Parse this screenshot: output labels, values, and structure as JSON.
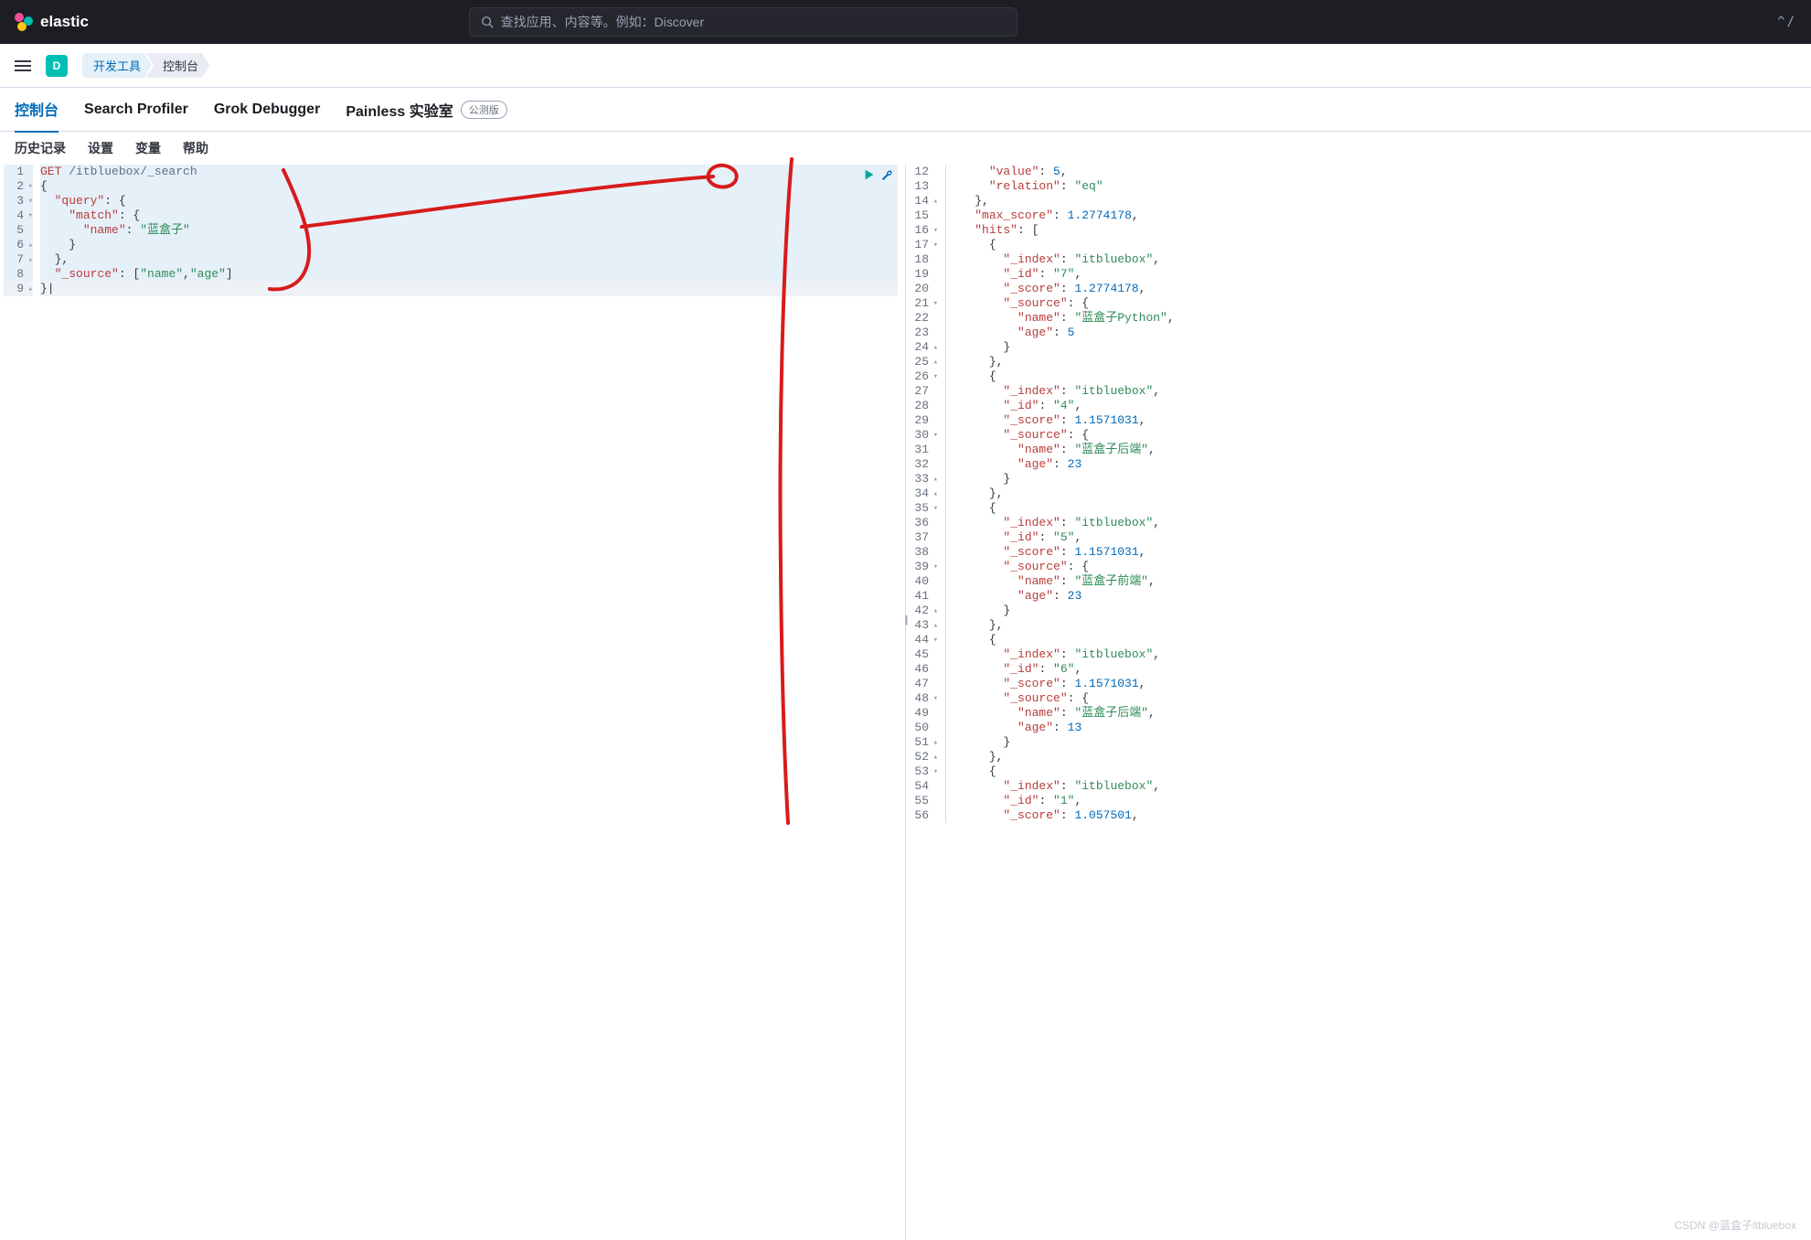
{
  "header": {
    "brand": "elastic",
    "search_placeholder": "查找应用、内容等。例如：Discover",
    "shortcut": "^/"
  },
  "breadcrumb": {
    "badge": "D",
    "items": [
      "开发工具",
      "控制台"
    ]
  },
  "tabs": [
    {
      "label": "控制台",
      "active": true
    },
    {
      "label": "Search Profiler"
    },
    {
      "label": "Grok Debugger"
    },
    {
      "label": "Painless 实验室",
      "badge": "公测版"
    }
  ],
  "subtabs": [
    "历史记录",
    "设置",
    "变量",
    "帮助"
  ],
  "request": {
    "lines": [
      {
        "n": 1,
        "fold": "",
        "hl": true,
        "tokens": [
          [
            "method",
            "GET"
          ],
          [
            "plain",
            " "
          ],
          [
            "path",
            "/itbluebox/_search"
          ]
        ]
      },
      {
        "n": 2,
        "fold": "▾",
        "hl": true,
        "tokens": [
          [
            "punct",
            "{"
          ]
        ]
      },
      {
        "n": 3,
        "fold": "▾",
        "hl": true,
        "tokens": [
          [
            "plain",
            "  "
          ],
          [
            "key",
            "\"query\""
          ],
          [
            "punct",
            ": {"
          ]
        ]
      },
      {
        "n": 4,
        "fold": "▾",
        "hl": true,
        "tokens": [
          [
            "plain",
            "    "
          ],
          [
            "key",
            "\"match\""
          ],
          [
            "punct",
            ": {"
          ]
        ]
      },
      {
        "n": 5,
        "fold": "",
        "hl": true,
        "tokens": [
          [
            "plain",
            "      "
          ],
          [
            "key",
            "\"name\""
          ],
          [
            "punct",
            ": "
          ],
          [
            "str",
            "\"蓝盒子\""
          ]
        ]
      },
      {
        "n": 6,
        "fold": "▴",
        "hl": true,
        "tokens": [
          [
            "plain",
            "    "
          ],
          [
            "punct",
            "}"
          ]
        ]
      },
      {
        "n": 7,
        "fold": "▴",
        "hl": true,
        "tokens": [
          [
            "plain",
            "  "
          ],
          [
            "punct",
            "},"
          ]
        ]
      },
      {
        "n": 8,
        "fold": "",
        "hl": true,
        "tokens": [
          [
            "plain",
            "  "
          ],
          [
            "key",
            "\"_source\""
          ],
          [
            "punct",
            ": ["
          ],
          [
            "str",
            "\"name\""
          ],
          [
            "punct",
            ","
          ],
          [
            "str",
            "\"age\""
          ],
          [
            "punct",
            "]"
          ]
        ]
      },
      {
        "n": 9,
        "fold": "▴",
        "hl": true,
        "hl2": true,
        "tokens": [
          [
            "punct",
            "}|"
          ]
        ]
      }
    ]
  },
  "response": {
    "lines": [
      {
        "n": 12,
        "fold": "",
        "tokens": [
          [
            "plain",
            "      "
          ],
          [
            "key",
            "\"value\""
          ],
          [
            "punct",
            ": "
          ],
          [
            "num",
            "5"
          ],
          [
            "punct",
            ","
          ]
        ]
      },
      {
        "n": 13,
        "fold": "",
        "tokens": [
          [
            "plain",
            "      "
          ],
          [
            "key",
            "\"relation\""
          ],
          [
            "punct",
            ": "
          ],
          [
            "str",
            "\"eq\""
          ]
        ]
      },
      {
        "n": 14,
        "fold": "▴",
        "tokens": [
          [
            "plain",
            "    "
          ],
          [
            "punct",
            "},"
          ]
        ]
      },
      {
        "n": 15,
        "fold": "",
        "tokens": [
          [
            "plain",
            "    "
          ],
          [
            "key",
            "\"max_score\""
          ],
          [
            "punct",
            ": "
          ],
          [
            "num",
            "1.2774178"
          ],
          [
            "punct",
            ","
          ]
        ]
      },
      {
        "n": 16,
        "fold": "▾",
        "tokens": [
          [
            "plain",
            "    "
          ],
          [
            "key",
            "\"hits\""
          ],
          [
            "punct",
            ": ["
          ]
        ]
      },
      {
        "n": 17,
        "fold": "▾",
        "tokens": [
          [
            "plain",
            "      "
          ],
          [
            "punct",
            "{"
          ]
        ]
      },
      {
        "n": 18,
        "fold": "",
        "tokens": [
          [
            "plain",
            "        "
          ],
          [
            "key",
            "\"_index\""
          ],
          [
            "punct",
            ": "
          ],
          [
            "str",
            "\"itbluebox\""
          ],
          [
            "punct",
            ","
          ]
        ]
      },
      {
        "n": 19,
        "fold": "",
        "tokens": [
          [
            "plain",
            "        "
          ],
          [
            "key",
            "\"_id\""
          ],
          [
            "punct",
            ": "
          ],
          [
            "str",
            "\"7\""
          ],
          [
            "punct",
            ","
          ]
        ]
      },
      {
        "n": 20,
        "fold": "",
        "tokens": [
          [
            "plain",
            "        "
          ],
          [
            "key",
            "\"_score\""
          ],
          [
            "punct",
            ": "
          ],
          [
            "num",
            "1.2774178"
          ],
          [
            "punct",
            ","
          ]
        ]
      },
      {
        "n": 21,
        "fold": "▾",
        "tokens": [
          [
            "plain",
            "        "
          ],
          [
            "key",
            "\"_source\""
          ],
          [
            "punct",
            ": {"
          ]
        ]
      },
      {
        "n": 22,
        "fold": "",
        "tokens": [
          [
            "plain",
            "          "
          ],
          [
            "key",
            "\"name\""
          ],
          [
            "punct",
            ": "
          ],
          [
            "str",
            "\"蓝盒子Python\""
          ],
          [
            "punct",
            ","
          ]
        ]
      },
      {
        "n": 23,
        "fold": "",
        "tokens": [
          [
            "plain",
            "          "
          ],
          [
            "key",
            "\"age\""
          ],
          [
            "punct",
            ": "
          ],
          [
            "num",
            "5"
          ]
        ]
      },
      {
        "n": 24,
        "fold": "▴",
        "tokens": [
          [
            "plain",
            "        "
          ],
          [
            "punct",
            "}"
          ]
        ]
      },
      {
        "n": 25,
        "fold": "▴",
        "tokens": [
          [
            "plain",
            "      "
          ],
          [
            "punct",
            "},"
          ]
        ]
      },
      {
        "n": 26,
        "fold": "▾",
        "tokens": [
          [
            "plain",
            "      "
          ],
          [
            "punct",
            "{"
          ]
        ]
      },
      {
        "n": 27,
        "fold": "",
        "tokens": [
          [
            "plain",
            "        "
          ],
          [
            "key",
            "\"_index\""
          ],
          [
            "punct",
            ": "
          ],
          [
            "str",
            "\"itbluebox\""
          ],
          [
            "punct",
            ","
          ]
        ]
      },
      {
        "n": 28,
        "fold": "",
        "tokens": [
          [
            "plain",
            "        "
          ],
          [
            "key",
            "\"_id\""
          ],
          [
            "punct",
            ": "
          ],
          [
            "str",
            "\"4\""
          ],
          [
            "punct",
            ","
          ]
        ]
      },
      {
        "n": 29,
        "fold": "",
        "tokens": [
          [
            "plain",
            "        "
          ],
          [
            "key",
            "\"_score\""
          ],
          [
            "punct",
            ": "
          ],
          [
            "num",
            "1.1571031"
          ],
          [
            "punct",
            ","
          ]
        ]
      },
      {
        "n": 30,
        "fold": "▾",
        "tokens": [
          [
            "plain",
            "        "
          ],
          [
            "key",
            "\"_source\""
          ],
          [
            "punct",
            ": {"
          ]
        ]
      },
      {
        "n": 31,
        "fold": "",
        "tokens": [
          [
            "plain",
            "          "
          ],
          [
            "key",
            "\"name\""
          ],
          [
            "punct",
            ": "
          ],
          [
            "str",
            "\"蓝盒子后端\""
          ],
          [
            "punct",
            ","
          ]
        ]
      },
      {
        "n": 32,
        "fold": "",
        "tokens": [
          [
            "plain",
            "          "
          ],
          [
            "key",
            "\"age\""
          ],
          [
            "punct",
            ": "
          ],
          [
            "num",
            "23"
          ]
        ]
      },
      {
        "n": 33,
        "fold": "▴",
        "tokens": [
          [
            "plain",
            "        "
          ],
          [
            "punct",
            "}"
          ]
        ]
      },
      {
        "n": 34,
        "fold": "▴",
        "tokens": [
          [
            "plain",
            "      "
          ],
          [
            "punct",
            "},"
          ]
        ]
      },
      {
        "n": 35,
        "fold": "▾",
        "tokens": [
          [
            "plain",
            "      "
          ],
          [
            "punct",
            "{"
          ]
        ]
      },
      {
        "n": 36,
        "fold": "",
        "tokens": [
          [
            "plain",
            "        "
          ],
          [
            "key",
            "\"_index\""
          ],
          [
            "punct",
            ": "
          ],
          [
            "str",
            "\"itbluebox\""
          ],
          [
            "punct",
            ","
          ]
        ]
      },
      {
        "n": 37,
        "fold": "",
        "tokens": [
          [
            "plain",
            "        "
          ],
          [
            "key",
            "\"_id\""
          ],
          [
            "punct",
            ": "
          ],
          [
            "str",
            "\"5\""
          ],
          [
            "punct",
            ","
          ]
        ]
      },
      {
        "n": 38,
        "fold": "",
        "tokens": [
          [
            "plain",
            "        "
          ],
          [
            "key",
            "\"_score\""
          ],
          [
            "punct",
            ": "
          ],
          [
            "num",
            "1.1571031"
          ],
          [
            "punct",
            ","
          ]
        ]
      },
      {
        "n": 39,
        "fold": "▾",
        "tokens": [
          [
            "plain",
            "        "
          ],
          [
            "key",
            "\"_source\""
          ],
          [
            "punct",
            ": {"
          ]
        ]
      },
      {
        "n": 40,
        "fold": "",
        "tokens": [
          [
            "plain",
            "          "
          ],
          [
            "key",
            "\"name\""
          ],
          [
            "punct",
            ": "
          ],
          [
            "str",
            "\"蓝盒子前端\""
          ],
          [
            "punct",
            ","
          ]
        ]
      },
      {
        "n": 41,
        "fold": "",
        "tokens": [
          [
            "plain",
            "          "
          ],
          [
            "key",
            "\"age\""
          ],
          [
            "punct",
            ": "
          ],
          [
            "num",
            "23"
          ]
        ]
      },
      {
        "n": 42,
        "fold": "▴",
        "tokens": [
          [
            "plain",
            "        "
          ],
          [
            "punct",
            "}"
          ]
        ]
      },
      {
        "n": 43,
        "fold": "▴",
        "tokens": [
          [
            "plain",
            "      "
          ],
          [
            "punct",
            "},"
          ]
        ]
      },
      {
        "n": 44,
        "fold": "▾",
        "tokens": [
          [
            "plain",
            "      "
          ],
          [
            "punct",
            "{"
          ]
        ]
      },
      {
        "n": 45,
        "fold": "",
        "tokens": [
          [
            "plain",
            "        "
          ],
          [
            "key",
            "\"_index\""
          ],
          [
            "punct",
            ": "
          ],
          [
            "str",
            "\"itbluebox\""
          ],
          [
            "punct",
            ","
          ]
        ]
      },
      {
        "n": 46,
        "fold": "",
        "tokens": [
          [
            "plain",
            "        "
          ],
          [
            "key",
            "\"_id\""
          ],
          [
            "punct",
            ": "
          ],
          [
            "str",
            "\"6\""
          ],
          [
            "punct",
            ","
          ]
        ]
      },
      {
        "n": 47,
        "fold": "",
        "tokens": [
          [
            "plain",
            "        "
          ],
          [
            "key",
            "\"_score\""
          ],
          [
            "punct",
            ": "
          ],
          [
            "num",
            "1.1571031"
          ],
          [
            "punct",
            ","
          ]
        ]
      },
      {
        "n": 48,
        "fold": "▾",
        "tokens": [
          [
            "plain",
            "        "
          ],
          [
            "key",
            "\"_source\""
          ],
          [
            "punct",
            ": {"
          ]
        ]
      },
      {
        "n": 49,
        "fold": "",
        "tokens": [
          [
            "plain",
            "          "
          ],
          [
            "key",
            "\"name\""
          ],
          [
            "punct",
            ": "
          ],
          [
            "str",
            "\"蓝盒子后端\""
          ],
          [
            "punct",
            ","
          ]
        ]
      },
      {
        "n": 50,
        "fold": "",
        "tokens": [
          [
            "plain",
            "          "
          ],
          [
            "key",
            "\"age\""
          ],
          [
            "punct",
            ": "
          ],
          [
            "num",
            "13"
          ]
        ]
      },
      {
        "n": 51,
        "fold": "▴",
        "tokens": [
          [
            "plain",
            "        "
          ],
          [
            "punct",
            "}"
          ]
        ]
      },
      {
        "n": 52,
        "fold": "▴",
        "tokens": [
          [
            "plain",
            "      "
          ],
          [
            "punct",
            "},"
          ]
        ]
      },
      {
        "n": 53,
        "fold": "▾",
        "tokens": [
          [
            "plain",
            "      "
          ],
          [
            "punct",
            "{"
          ]
        ]
      },
      {
        "n": 54,
        "fold": "",
        "tokens": [
          [
            "plain",
            "        "
          ],
          [
            "key",
            "\"_index\""
          ],
          [
            "punct",
            ": "
          ],
          [
            "str",
            "\"itbluebox\""
          ],
          [
            "punct",
            ","
          ]
        ]
      },
      {
        "n": 55,
        "fold": "",
        "tokens": [
          [
            "plain",
            "        "
          ],
          [
            "key",
            "\"_id\""
          ],
          [
            "punct",
            ": "
          ],
          [
            "str",
            "\"1\""
          ],
          [
            "punct",
            ","
          ]
        ]
      },
      {
        "n": 56,
        "fold": "",
        "tokens": [
          [
            "plain",
            "        "
          ],
          [
            "key",
            "\"_score\""
          ],
          [
            "punct",
            ": "
          ],
          [
            "num",
            "1.057501"
          ],
          [
            "punct",
            ","
          ]
        ]
      }
    ]
  },
  "watermark": "CSDN @蓝盒子itbluebox"
}
